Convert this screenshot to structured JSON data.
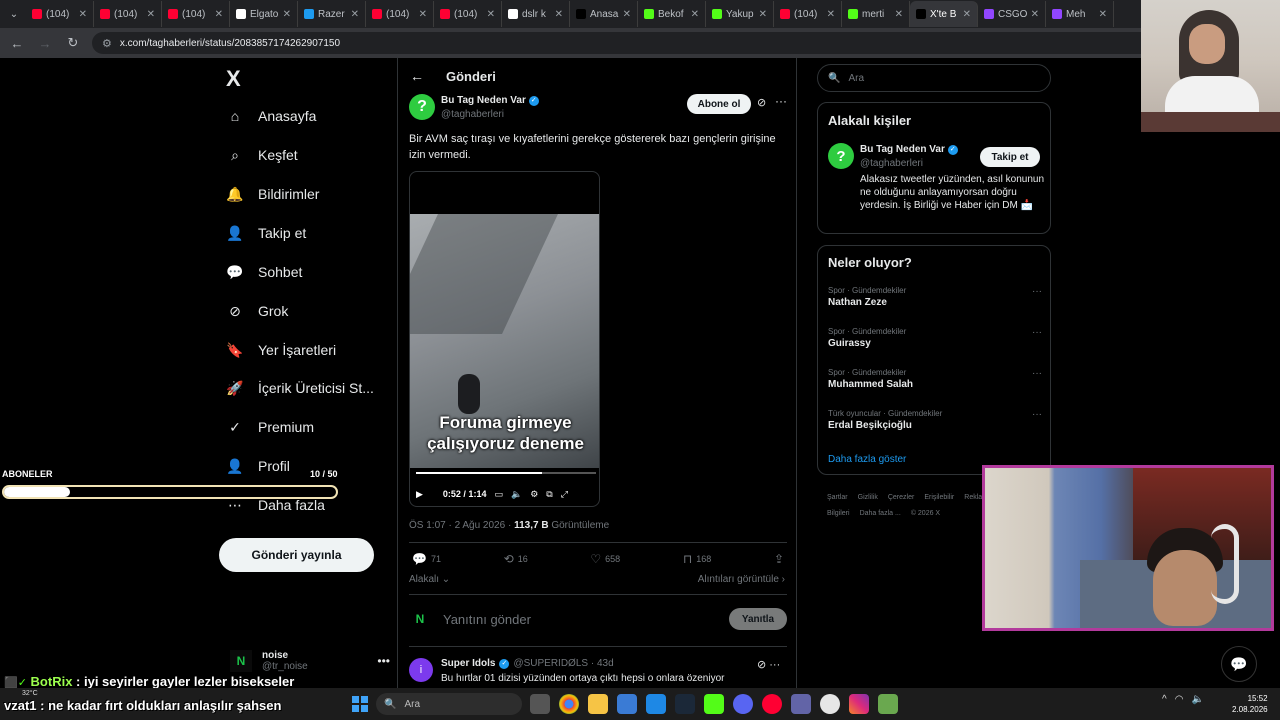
{
  "browser": {
    "tabs": [
      {
        "title": "(104)",
        "color": "#ff0033"
      },
      {
        "title": "(104)",
        "color": "#ff0033"
      },
      {
        "title": "(104)",
        "color": "#ff0033"
      },
      {
        "title": "Elgato",
        "color": "#ffffff"
      },
      {
        "title": "Razer",
        "color": "#1d9bf0"
      },
      {
        "title": "(104)",
        "color": "#ff0033"
      },
      {
        "title": "(104)",
        "color": "#ff0033"
      },
      {
        "title": "dslr k",
        "color": "#ffffff"
      },
      {
        "title": "Anasa",
        "color": "#000000"
      },
      {
        "title": "Bekof",
        "color": "#53fc18"
      },
      {
        "title": "Yakup",
        "color": "#53fc18"
      },
      {
        "title": "(104)",
        "color": "#ff0033"
      },
      {
        "title": "merti",
        "color": "#53fc18"
      },
      {
        "title": "X'te B",
        "color": "#000000"
      },
      {
        "title": "CSGO",
        "color": "#9146ff"
      },
      {
        "title": "Meh",
        "color": "#9146ff"
      }
    ],
    "active_tab_index": 13,
    "url": "x.com/taghaberleri/status/2083857174262907150"
  },
  "nav": {
    "logo": "X",
    "items": [
      "Anasayfa",
      "Keşfet",
      "Bildirimler",
      "Takip et",
      "Sohbet",
      "Grok",
      "Yer İşaretleri",
      "İçerik Üreticisi St...",
      "Premium",
      "Profil",
      "Daha fazla"
    ],
    "post_button": "Gönderi yayınla",
    "account": {
      "name": "noise",
      "handle": "@tr_noise",
      "avatar": "N"
    }
  },
  "post": {
    "header": "Gönderi",
    "author": "Bu Tag Neden Var",
    "handle": "@taghaberleri",
    "subscribe": "Abone ol",
    "text": "Bir AVM saç tıraşı ve kıyafetlerini gerekçe göstererek bazı gençlerin girişine izin vermedi.",
    "video": {
      "caption": "Foruma girmeye çalışıyoruz deneme",
      "time": "0:52 / 1:14",
      "progress": 0.7
    },
    "meta_time": "ÖS 1:07 · 2 Ağu 2026 · ",
    "views": "113,7 B",
    "views_label": " Görüntüleme",
    "stats": {
      "replies": "71",
      "reposts": "16",
      "likes": "658",
      "bookmarks": "168"
    },
    "relevance": "Alakalı",
    "quotes": "Alıntıları görüntüle",
    "reply_placeholder": "Yanıtını gönder",
    "reply_button": "Yanıtla",
    "next": {
      "name": "Super Idols",
      "handle": "@SUPERIDØLS · 43d",
      "text": "Bu hırtlar 01 dizisi yüzünden ortaya çıktı hepsi o onlara özeniyor",
      "avatar": "i"
    }
  },
  "sidebar": {
    "search_placeholder": "Ara",
    "related_title": "Alakalı kişiler",
    "related": {
      "name": "Bu Tag Neden Var",
      "handle": "@taghaberleri",
      "follow": "Takip et",
      "bio": "Alakasız tweetler yüzünden, asıl konunun ne olduğunu anlayamıyorsan doğru yerdesin. İş Birliği ve Haber için DM 📩"
    },
    "trends_title": "Neler oluyor?",
    "trends": [
      {
        "cat": "Spor · Gündemdekiler",
        "title": "Nathan Zeze"
      },
      {
        "cat": "Spor · Gündemdekiler",
        "title": "Guirassy"
      },
      {
        "cat": "Spor · Gündemdekiler",
        "title": "Muhammed Salah"
      },
      {
        "cat": "Türk oyuncular · Gündemdekiler",
        "title": "Erdal Beşikçioğlu"
      }
    ],
    "show_more": "Daha fazla göster",
    "footer": [
      "Şartlar",
      "Gizlilik",
      "Çerezler",
      "Erişilebilir",
      "Reklam Bilgileri",
      "Daha fazla ...",
      "© 2026 X"
    ]
  },
  "overlay": {
    "subs_label": "ABONELER",
    "subs_count": "10 / 50",
    "subs_progress": 0.2,
    "chat": [
      {
        "user": "BotRix",
        "msg": " : iyi seyirler gayler lezler bisekseler"
      },
      {
        "user": "vzat1",
        "msg": " : ne kadar fırt oldukları anlaşılır şahsen"
      }
    ]
  },
  "taskbar": {
    "search": "Ara",
    "weather": "32°C",
    "time": "15:52",
    "date": "2.08.2026"
  }
}
